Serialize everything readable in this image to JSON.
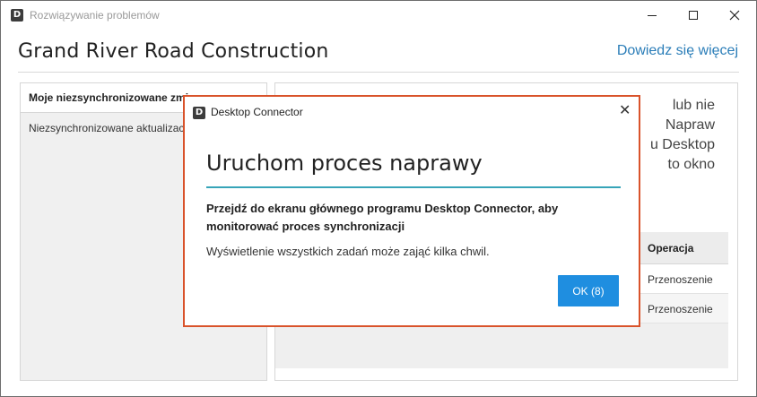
{
  "window": {
    "title": "Rozwiązywanie problemów",
    "icon_letter": "D"
  },
  "header": {
    "project_title": "Grand River Road Construction",
    "learn_more_link": "Dowiedz się więcej"
  },
  "left_panel": {
    "header": "Moje niezsynchronizowane zmi",
    "row": "Niezsynchronizowane aktualizacj"
  },
  "right_panel": {
    "text_lines": [
      "lub nie",
      "Napraw",
      "u Desktop",
      "to okno"
    ],
    "table": {
      "operation_header": "Operacja",
      "rows": [
        "Przenoszenie",
        "Przenoszenie"
      ]
    }
  },
  "dialog": {
    "title": "Desktop Connector",
    "icon_letter": "D",
    "heading": "Uruchom proces naprawy",
    "bold_text": "Przejdź do ekranu głównego programu Desktop Connector, aby monitorować proces synchronizacji",
    "note": "Wyświetlenie wszystkich zadań może zająć kilka chwil.",
    "ok_label": "OK (8)",
    "close_glyph": "✕"
  },
  "colors": {
    "dialog_border": "#d9532b",
    "accent_rule": "#36a4b8",
    "ok_button": "#1f8ee0",
    "link": "#2a7db8"
  }
}
